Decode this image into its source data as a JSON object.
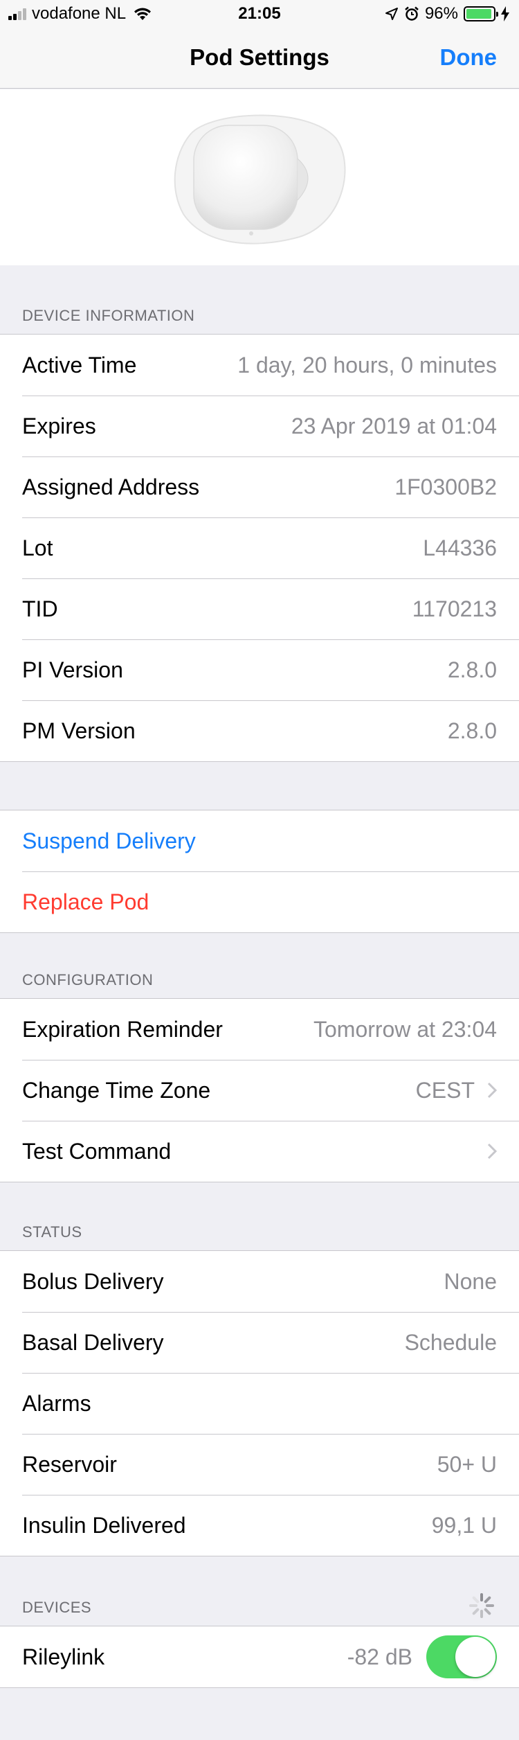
{
  "status_bar": {
    "carrier": "vodafone NL",
    "time": "21:05",
    "battery_percent": "96%",
    "battery_level": 0.96
  },
  "nav": {
    "title": "Pod Settings",
    "done_label": "Done"
  },
  "device_information": {
    "header": "DEVICE INFORMATION",
    "rows": [
      {
        "label": "Active Time",
        "value": "1 day, 20 hours, 0 minutes"
      },
      {
        "label": "Expires",
        "value": "23 Apr 2019 at 01:04"
      },
      {
        "label": "Assigned Address",
        "value": "1F0300B2"
      },
      {
        "label": "Lot",
        "value": "L44336"
      },
      {
        "label": "TID",
        "value": "1170213"
      },
      {
        "label": "PI Version",
        "value": "2.8.0"
      },
      {
        "label": "PM Version",
        "value": "2.8.0"
      }
    ]
  },
  "actions": {
    "suspend_label": "Suspend Delivery",
    "replace_label": "Replace Pod"
  },
  "configuration": {
    "header": "CONFIGURATION",
    "rows": [
      {
        "label": "Expiration Reminder",
        "value": "Tomorrow at 23:04"
      },
      {
        "label": "Change Time Zone",
        "value": "CEST"
      },
      {
        "label": "Test Command",
        "value": ""
      }
    ]
  },
  "status": {
    "header": "STATUS",
    "rows": [
      {
        "label": "Bolus Delivery",
        "value": "None"
      },
      {
        "label": "Basal Delivery",
        "value": "Schedule"
      },
      {
        "label": "Alarms",
        "value": ""
      },
      {
        "label": "Reservoir",
        "value": "50+ U"
      },
      {
        "label": "Insulin Delivered",
        "value": "99,1 U"
      }
    ]
  },
  "devices": {
    "header": "DEVICES",
    "rows": [
      {
        "label": "Rileylink",
        "value": "-82 dB",
        "toggle_on": true
      }
    ]
  },
  "colors": {
    "tint": "#157efb",
    "destructive": "#ff3b30",
    "toggle_on": "#4cd964"
  },
  "icons": [
    "signal-icon",
    "wifi-icon",
    "location-icon",
    "alarm-icon",
    "battery-icon",
    "charging-icon",
    "pod-image",
    "chevron-right-icon",
    "activity-spinner-icon"
  ]
}
